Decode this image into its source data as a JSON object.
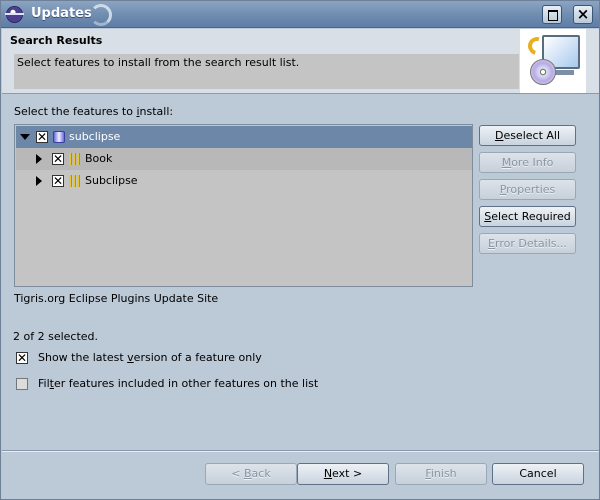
{
  "window": {
    "title": "Updates"
  },
  "banner": {
    "title": "Search Results",
    "message": "Select features to install from the search result list."
  },
  "tree": {
    "label_prefix": "Select the features to ",
    "label_mnemonic": "i",
    "label_suffix": "nstall:",
    "items": [
      {
        "label": "subclipse",
        "checked": "✕",
        "icon": "subclipse-icon",
        "expanded": true,
        "selected": true
      },
      {
        "label": "Book",
        "checked": "✕",
        "icon": "feature-bars-icon",
        "expanded": false,
        "selected": false
      },
      {
        "label": "Subclipse",
        "checked": "✕",
        "icon": "feature-bars-icon",
        "expanded": false,
        "selected": false
      }
    ]
  },
  "side_buttons": {
    "deselect_all": {
      "mnemonic": "D",
      "rest": "eselect All"
    },
    "more_info": {
      "mnemonic": "M",
      "rest": "ore Info"
    },
    "properties": {
      "mnemonic": "P",
      "rest": "roperties"
    },
    "select_required": {
      "mnemonic": "S",
      "rest": "elect Required"
    },
    "error_details": {
      "mnemonic": "E",
      "rest": "rror Details..."
    }
  },
  "site_description": "Tigris.org Eclipse Plugins Update Site",
  "selection_count": "2 of 2 selected.",
  "options": {
    "latest_version": {
      "prefix": "Show the latest ",
      "mnemonic": "v",
      "suffix": "ersion of a feature only",
      "checked": "✕"
    },
    "filter_included": {
      "prefix": "Fil",
      "mnemonic": "t",
      "suffix": "er features included in other features on the list",
      "checked": ""
    }
  },
  "footer": {
    "back": {
      "prefix": "< ",
      "mnemonic": "B",
      "rest": "ack"
    },
    "next": {
      "mnemonic": "N",
      "rest": "ext >"
    },
    "finish": {
      "mnemonic": "F",
      "rest": "inish"
    },
    "cancel": "Cancel"
  }
}
